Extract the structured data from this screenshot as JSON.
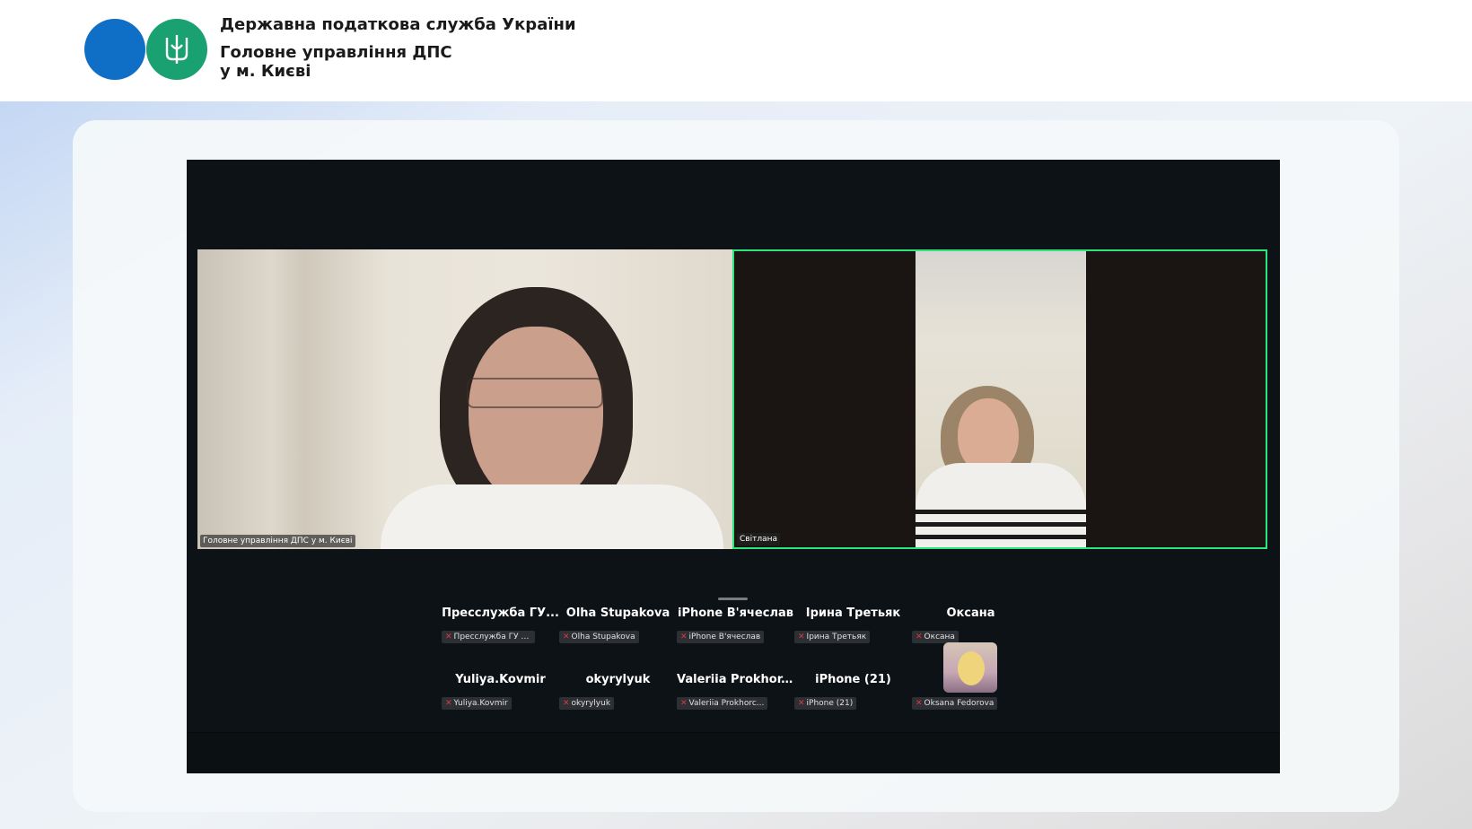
{
  "header": {
    "org_name": "Державна податкова служба України",
    "org_sub_line1": "Головне управління ДПС",
    "org_sub_line2": "у м. Києві"
  },
  "colors": {
    "brand_blue": "#0f6fc6",
    "brand_green": "#19a171",
    "active_speaker_border": "#2ee57d",
    "meeting_background": "#0d1216",
    "muted_mic": "#e0383b"
  },
  "video_tiles": [
    {
      "name": "Головне управління ДПС у м. Києві",
      "active_speaker": false
    },
    {
      "name": "Світлана",
      "active_speaker": true
    }
  ],
  "participants": [
    {
      "name": "Пресслужба ГУ...",
      "chip": "Пресслужба ГУ ДПС...",
      "mic_icon": "mic-muted-icon"
    },
    {
      "name": "Olha Stupakova",
      "chip": "Olha Stupakova",
      "mic_icon": "mic-muted-icon"
    },
    {
      "name": "iPhone В'ячеслав",
      "chip": "iPhone В'ячеслав",
      "mic_icon": "mic-muted-icon"
    },
    {
      "name": "Ірина Третьяк",
      "chip": "Ірина Третьяк",
      "mic_icon": "mic-muted-icon"
    },
    {
      "name": "Оксана",
      "chip": "Оксана",
      "mic_icon": "mic-muted-icon"
    },
    {
      "name": "Yuliya.Kovmir",
      "chip": "Yuliya.Kovmir",
      "mic_icon": "mic-muted-icon"
    },
    {
      "name": "okyrylyuk",
      "chip": "okyrylyuk",
      "mic_icon": "mic-muted-icon"
    },
    {
      "name": "Valeriia Prokhor...",
      "chip": "Valeriia Prokhorc...",
      "mic_icon": "mic-muted-icon"
    },
    {
      "name": "iPhone (21)",
      "chip": "iPhone (21)",
      "mic_icon": "mic-muted-icon"
    },
    {
      "name": "",
      "chip": "Oksana Fedorova",
      "mic_icon": "mic-muted-icon",
      "has_photo": true
    }
  ]
}
